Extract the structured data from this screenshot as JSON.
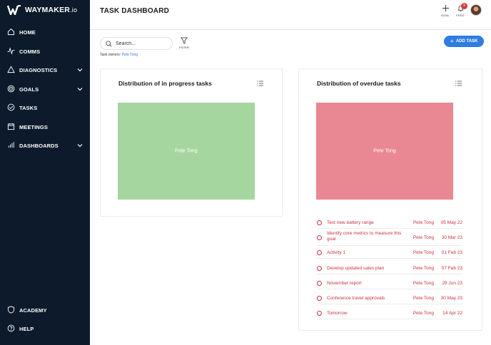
{
  "app": {
    "brand": "WAYMAKER",
    "brand_suffix": ".io"
  },
  "sidebar": {
    "items": [
      {
        "label": "HOME",
        "icon": "home-icon"
      },
      {
        "label": "COMMS",
        "icon": "pulse-icon"
      },
      {
        "label": "DIAGNOSTICS",
        "icon": "triangle-icon",
        "expandable": true
      },
      {
        "label": "GOALS",
        "icon": "target-icon",
        "expandable": true
      },
      {
        "label": "TASKS",
        "icon": "check-circle-icon"
      },
      {
        "label": "MEETINGS",
        "icon": "calendar-icon"
      },
      {
        "label": "DASHBOARDS",
        "icon": "bar-chart-icon",
        "expandable": true
      }
    ],
    "bottom": [
      {
        "label": "ACADEMY",
        "icon": "shield-icon"
      },
      {
        "label": "HELP",
        "icon": "help-icon"
      }
    ]
  },
  "header": {
    "title": "TASK DASHBOARD",
    "goal_label": "GOAL",
    "feed_label": "FEED",
    "feed_badge": "9"
  },
  "toolbar": {
    "search_placeholder": "Search...",
    "filter_label": "FILTER",
    "owners_label": "Task owners:",
    "owners_value": "Pete Tong",
    "add_task_label": "ADD TASK"
  },
  "cards": {
    "in_progress": {
      "title": "Distribution of in progress tasks",
      "color": "#a6d6a0"
    },
    "overdue": {
      "title": "Distribution of overdue tasks",
      "color": "#e98893"
    }
  },
  "chart_data": [
    {
      "type": "treemap",
      "title": "Distribution of in progress tasks",
      "categories": [
        "Pete Tong"
      ],
      "values": [
        1
      ],
      "color": "#a6d6a0"
    },
    {
      "type": "treemap",
      "title": "Distribution of overdue tasks",
      "categories": [
        "Pete Tong"
      ],
      "values": [
        1
      ],
      "color": "#e98893"
    }
  ],
  "overdue_tasks": [
    {
      "name": "Test new battery range",
      "owner": "Pete Tong",
      "date": "05 May 22"
    },
    {
      "name": "Identify core metrics to measure this goal",
      "owner": "Pete Tong",
      "date": "30 Mar 23"
    },
    {
      "name": "Activity 1",
      "owner": "Pete Tong",
      "date": "01 Feb 23"
    },
    {
      "name": "Develop updated sales plan",
      "owner": "Pete Tong",
      "date": "07 Feb 23"
    },
    {
      "name": "November report",
      "owner": "Pete Tong",
      "date": "29 Jun 23"
    },
    {
      "name": "Conference travel approvals",
      "owner": "Pete Tong",
      "date": "30 May 23"
    },
    {
      "name": "Tomorrow",
      "owner": "Pete Tong",
      "date": "14 Apr 22"
    }
  ],
  "colors": {
    "sidebar_bg": "#0c1a2b",
    "accent": "#2f7de1",
    "overdue_text": "#c8323f",
    "badge": "#d73838"
  }
}
